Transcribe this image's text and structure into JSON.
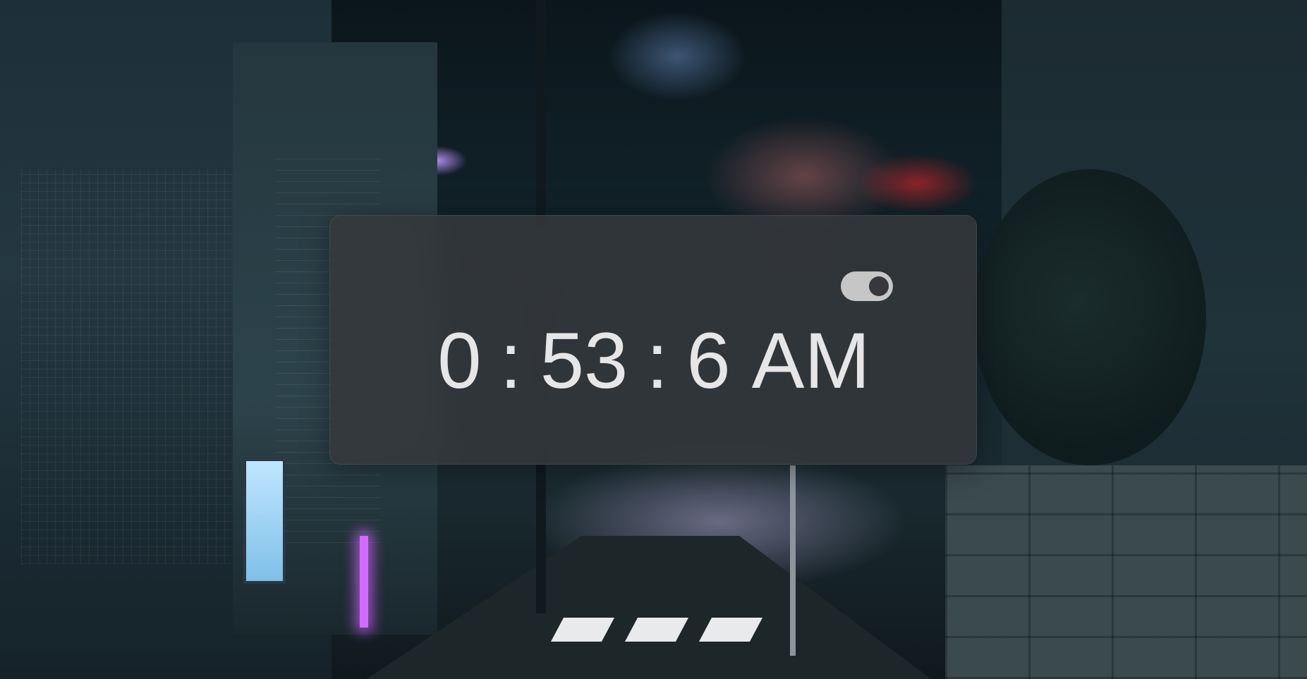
{
  "clock": {
    "hours": "0",
    "separator": ":",
    "minutes": "53",
    "seconds": "6",
    "period": "AM"
  },
  "format_toggle": {
    "state": "on"
  },
  "colors": {
    "panel": "#36383c",
    "clock_text": "#e6e6e6",
    "toggle_track": "#c6c6c6"
  },
  "icons": {
    "toggle": "toggle-switch-icon"
  }
}
